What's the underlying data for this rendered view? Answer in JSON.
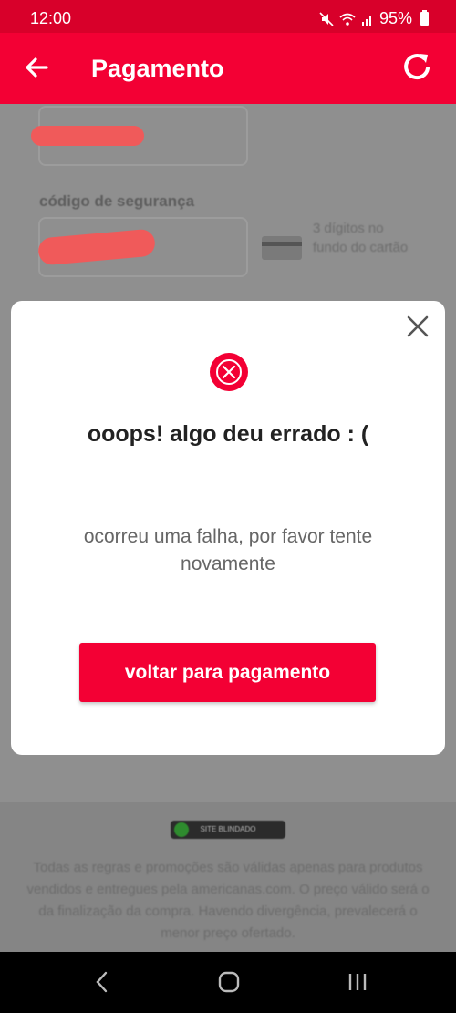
{
  "status_bar": {
    "time": "12:00",
    "battery": "95%",
    "icons": [
      "mute-icon",
      "wifi-icon",
      "signal-icon",
      "battery-icon"
    ]
  },
  "app_bar": {
    "title": "Pagamento",
    "back_icon": "arrow-left-icon",
    "refresh_icon": "refresh-icon",
    "background": "#f30034"
  },
  "background_form": {
    "security_label": "código de segurança",
    "security_hint": "3 dígitos no fundo do cartão"
  },
  "modal": {
    "close_icon": "close-icon",
    "error_icon": "error-x-icon",
    "title": "ooops! algo deu errado : (",
    "message": "ocorreu uma falha, por favor tente novamente",
    "button_label": "voltar para pagamento",
    "accent_color": "#f30034"
  },
  "footer": {
    "seal_text": "SITE BLINDADO",
    "disclaimer": "Todas as regras e promoções são válidas apenas para produtos vendidos e entregues pela americanas.com. O preço válido será o da finalização da compra. Havendo divergência, prevalecerá o menor preço ofertado."
  },
  "nav_bar": {
    "buttons": [
      "back-nav-icon",
      "home-nav-icon",
      "recents-nav-icon"
    ]
  }
}
